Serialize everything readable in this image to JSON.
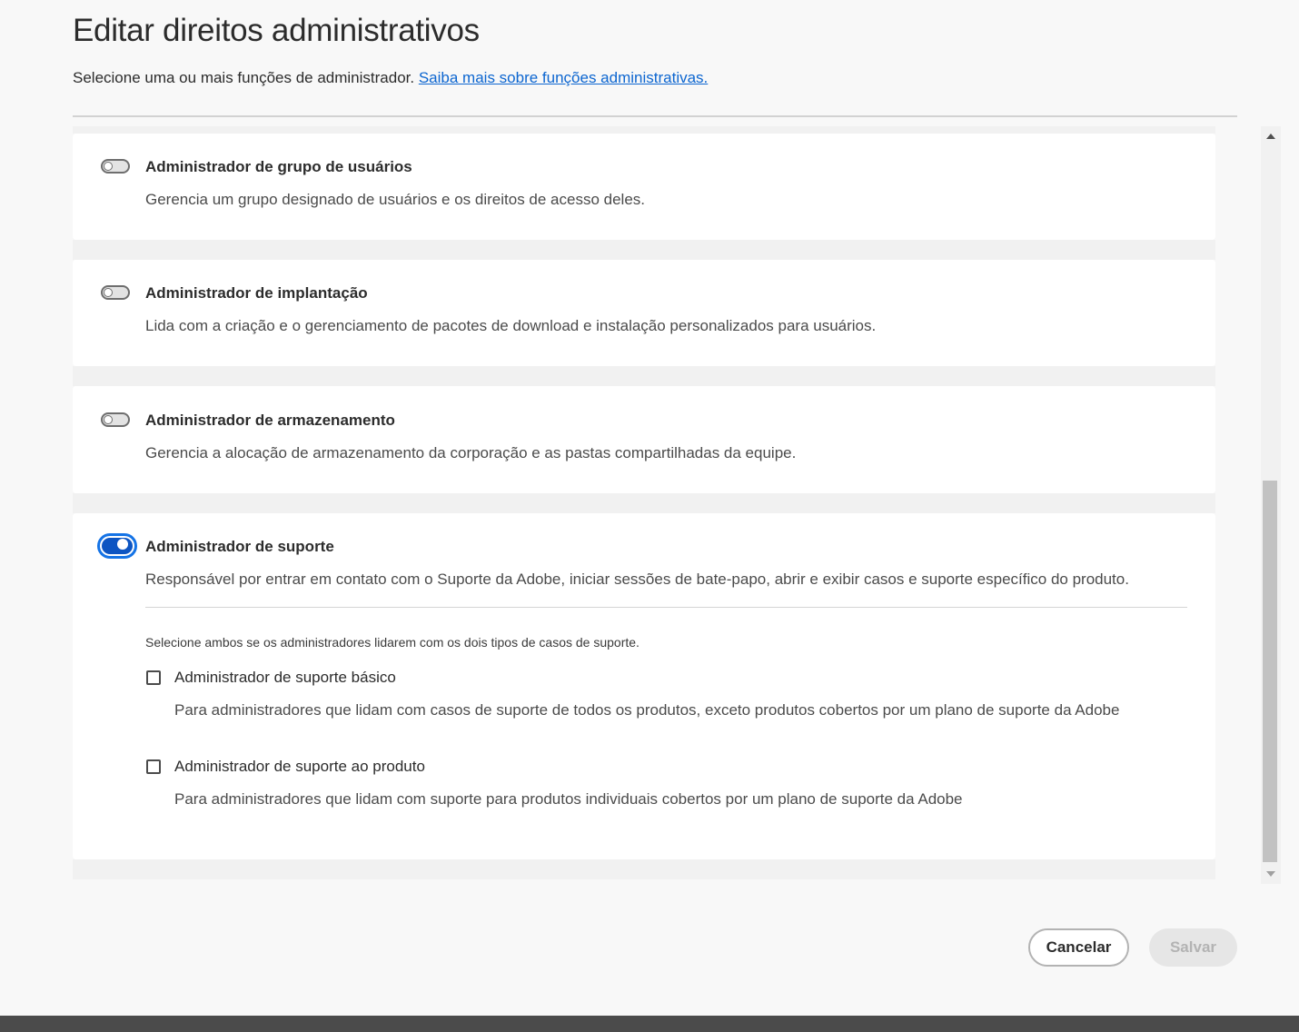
{
  "dialog": {
    "title": "Editar direitos administrativos",
    "subtitle": "Selecione uma ou mais funções de administrador.",
    "learn_more_link": "Saiba mais sobre funções administrativas."
  },
  "roles": [
    {
      "title": "Administrador de grupo de usuários",
      "description": "Gerencia um grupo designado de usuários e os direitos de acesso deles.",
      "enabled": false
    },
    {
      "title": "Administrador de implantação",
      "description": "Lida com a criação e o gerenciamento de pacotes de download e instalação personalizados para usuários.",
      "enabled": false
    },
    {
      "title": "Administrador de armazenamento",
      "description": "Gerencia a alocação de armazenamento da corporação e as pastas compartilhadas da equipe.",
      "enabled": false
    },
    {
      "title": "Administrador de suporte",
      "description": "Responsável por entrar em contato com o Suporte da Adobe, iniciar sessões de bate-papo, abrir e exibir casos e suporte específico do produto.",
      "enabled": true,
      "hint": "Selecione ambos se os administradores lidarem com os dois tipos de casos de suporte.",
      "options": [
        {
          "label": "Administrador de suporte básico",
          "description": "Para administradores que lidam com casos de suporte de todos os produtos, exceto produtos cobertos por um plano de suporte da Adobe",
          "checked": false
        },
        {
          "label": "Administrador de suporte ao produto",
          "description": "Para administradores que lidam com suporte para produtos individuais cobertos por um plano de suporte da Adobe",
          "checked": false
        }
      ]
    }
  ],
  "footer": {
    "cancel_label": "Cancelar",
    "save_label": "Salvar"
  },
  "colors": {
    "accent": "#1473e6",
    "toggle_on": "#0d55c2",
    "link": "#0d66d0"
  }
}
